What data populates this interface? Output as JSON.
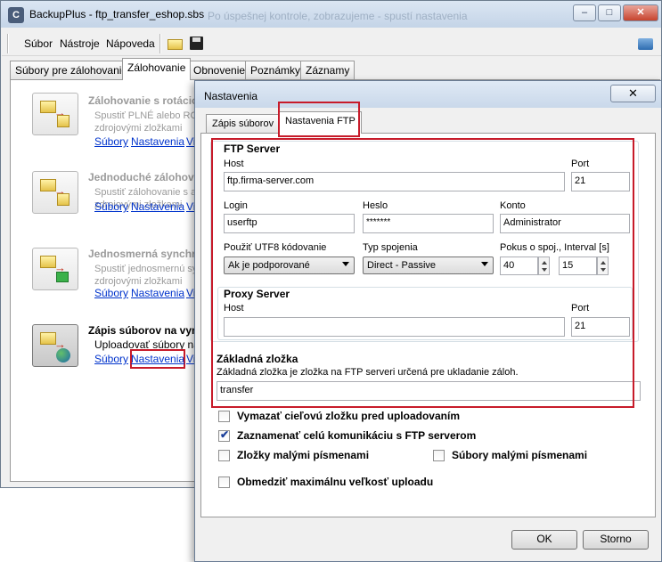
{
  "app": {
    "title": "BackupPlus - ftp_transfer_eshop.sbs",
    "title_ghost": "Po úspešnej kontrole, zobrazujeme - spustí nastavenia",
    "icon_letter": "C"
  },
  "menu": [
    "Súbor",
    "Nástroje",
    "Nápoveda"
  ],
  "main_tabs": [
    "Súbory pre zálohovanie",
    "Zálohovanie",
    "Obnovenie",
    "Poznámky",
    "Záznamy"
  ],
  "backup_items": [
    {
      "title": "Zálohovanie s rotáciou",
      "desc1": "Spustiť PLNÉ alebo ROZ",
      "desc2": "zdrojovými zložkami",
      "links": [
        "Súbory",
        "Nastavenia",
        "Vi"
      ]
    },
    {
      "title": "Jednoduché zálohova",
      "desc1": "Spustiť zálohovanie s ak",
      "desc2": "zdrojovými zložkami",
      "links": [
        "Súbory",
        "Nastavenia",
        "Vi"
      ]
    },
    {
      "title": "Jednosmerná synchro",
      "desc1": "Spustiť jednosmernú sync",
      "desc2": "zdrojovými zložkami",
      "links": [
        "Súbory",
        "Nastavenia",
        "Vi"
      ]
    },
    {
      "title": "Zápis súborov na vym",
      "desc1": "Uploadovať súbory na F",
      "desc2": "",
      "links": [
        "Súbory",
        "Nastavenia",
        "Vi"
      ]
    }
  ],
  "dialog": {
    "title": "Nastavenia",
    "close": "✕",
    "tabs": [
      "Zápis súborov",
      "Nastavenia FTP"
    ],
    "ftp_server": {
      "title": "FTP Server",
      "host_label": "Host",
      "host_value": "ftp.firma-server.com",
      "port_label": "Port",
      "port_value": "21",
      "login_label": "Login",
      "login_value": "userftp",
      "password_label": "Heslo",
      "password_value": "*******",
      "account_label": "Konto",
      "account_value": "Administrator",
      "utf8_label": "Použiť UTF8 kódovanie",
      "utf8_value": "Ak je podporované",
      "conn_type_label": "Typ spojenia",
      "conn_type_value": "Direct - Passive",
      "retries_label": "Pokus o spoj., Interval [s]",
      "retries_value": "40",
      "interval_value": "15"
    },
    "proxy_server": {
      "title": "Proxy Server",
      "host_label": "Host",
      "host_value": "",
      "port_label": "Port",
      "port_value": "21"
    },
    "base_folder": {
      "title": "Základná zložka",
      "desc": "Základná zložka je zložka na FTP serveri určená pre ukladanie záloh.",
      "value": "transfer"
    },
    "options": {
      "clear_target": {
        "label": "Vymazať cieľovú zložku pred uploadovaním",
        "checked": false
      },
      "log_all": {
        "label": "Zaznamenať celú komunikáciu s FTP serverom",
        "checked": true
      },
      "lowercase_folders": {
        "label": "Zložky malými písmenami",
        "checked": false
      },
      "lowercase_files": {
        "label": "Súbory malými písmenami",
        "checked": false
      },
      "limit_upload": {
        "label": "Obmedziť maximálnu veľkosť uploadu",
        "checked": false
      }
    },
    "ok_label": "OK",
    "cancel_label": "Storno"
  },
  "colors": {
    "highlight_red": "#c71b2a",
    "link_blue": "#0033cc"
  }
}
